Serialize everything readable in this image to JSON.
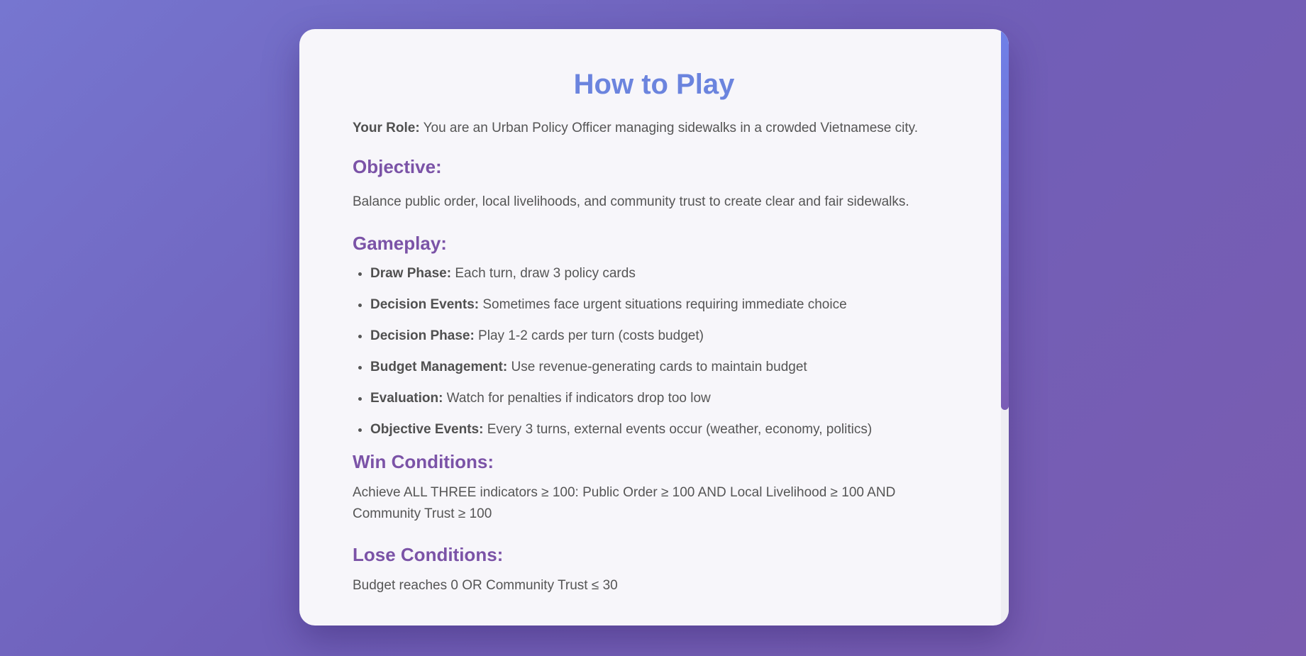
{
  "title": "How to Play",
  "role": {
    "label": "Your Role:",
    "text": " You are an Urban Policy Officer managing sidewalks in a crowded Vietnamese city."
  },
  "objective": {
    "heading": "Objective:",
    "text": "Balance public order, local livelihoods, and community trust to create clear and fair sidewalks."
  },
  "gameplay": {
    "heading": "Gameplay:",
    "items": [
      {
        "label": "Draw Phase:",
        "text": " Each turn, draw 3 policy cards"
      },
      {
        "label": "Decision Events:",
        "text": " Sometimes face urgent situations requiring immediate choice"
      },
      {
        "label": "Decision Phase:",
        "text": " Play 1-2 cards per turn (costs budget)"
      },
      {
        "label": "Budget Management:",
        "text": " Use revenue-generating cards to maintain budget"
      },
      {
        "label": "Evaluation:",
        "text": " Watch for penalties if indicators drop too low"
      },
      {
        "label": "Objective Events:",
        "text": " Every 3 turns, external events occur (weather, economy, politics)"
      }
    ]
  },
  "win": {
    "heading": "Win Conditions:",
    "text": "Achieve ALL THREE indicators ≥ 100: Public Order ≥ 100 AND Local Livelihood ≥ 100 AND Community Trust ≥ 100"
  },
  "lose": {
    "heading": "Lose Conditions:",
    "text": "Budget reaches 0 OR Community Trust ≤ 30"
  },
  "colors": {
    "title": "#6b84de",
    "heading": "#7b53a7",
    "body_text": "#555555",
    "modal_bg": "#f7f6fa"
  }
}
